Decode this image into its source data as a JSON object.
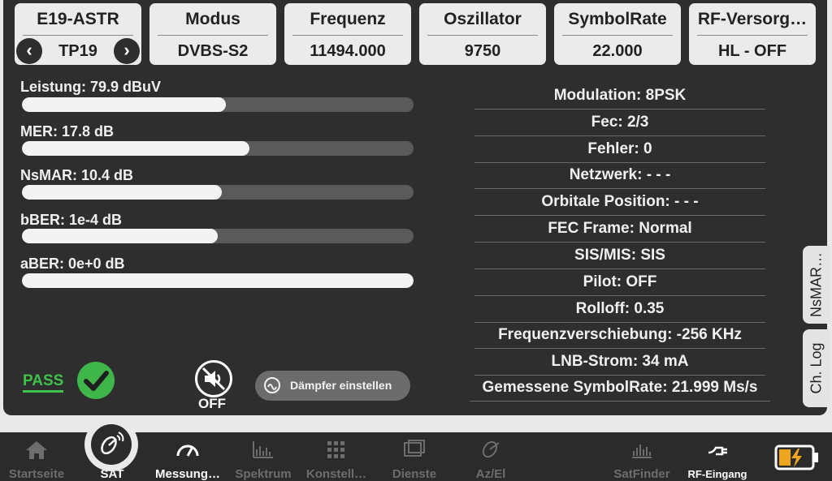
{
  "cards": [
    {
      "title": "E19-ASTR",
      "value": "TP19"
    },
    {
      "title": "Modus",
      "value": "DVBS-S2"
    },
    {
      "title": "Frequenz",
      "value": "11494.000"
    },
    {
      "title": "Oszillator",
      "value": "9750"
    },
    {
      "title": "SymbolRate",
      "value": "22.000"
    },
    {
      "title": "RF-Versorg…",
      "value": "HL - OFF"
    }
  ],
  "nav_arrows": {
    "prev": "‹",
    "next": "›"
  },
  "measurements": [
    {
      "label": "Leistung: 79.9 dBuV",
      "fill": 0.52
    },
    {
      "label": "MER: 17.8 dB",
      "fill": 0.58
    },
    {
      "label": "NsMAR: 10.4 dB",
      "fill": 0.51
    },
    {
      "label": "bBER: 1e-4 dB",
      "fill": 0.5
    },
    {
      "label": "aBER: 0e+0 dB",
      "fill": 1.0
    }
  ],
  "info": [
    "Modulation: 8PSK",
    "Fec: 2/3",
    "Fehler: 0",
    "Netzwerk: - - -",
    "Orbitale Position: - - -",
    "FEC Frame: Normal",
    "SIS/MIS: SIS",
    "Pilot: OFF",
    "Rolloff: 0.35",
    "Frequenzverschiebung: -256 KHz",
    "LNB-Strom: 34 mA",
    "Gemessene SymbolRate: 21.999 Ms/s"
  ],
  "side_tabs": {
    "nsmar": "NsMAR…",
    "chlog": "Ch. Log"
  },
  "status": {
    "pass": "PASS",
    "audio": "OFF"
  },
  "damp_button": "Dämpfer einstellen",
  "nav": {
    "home": "Startseite",
    "sat": "SAT",
    "messung": "Messung…",
    "spektrum": "Spektrum",
    "konstell": "Konstell…",
    "dienste": "Dienste",
    "azel": "Az/El",
    "satfinder": "SatFinder",
    "rf": "RF-Eingang"
  },
  "colors": {
    "pass": "#3fb64a",
    "accent": "#f0a520",
    "panel": "#2e2e2e"
  }
}
